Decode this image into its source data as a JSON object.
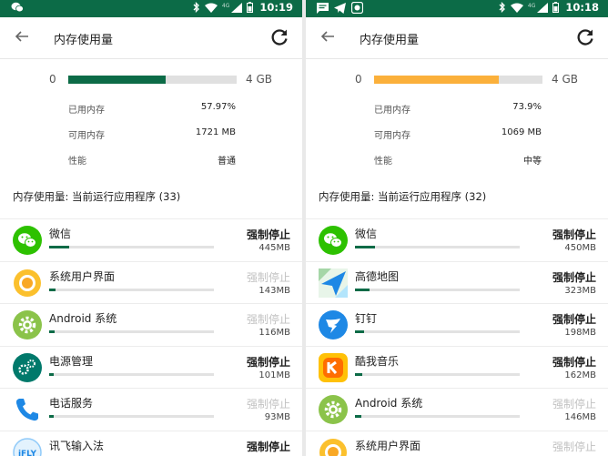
{
  "screens": [
    {
      "status": {
        "time": "10:19",
        "network": "4G"
      },
      "header": {
        "title": "内存使用量"
      },
      "summary": {
        "min": "0",
        "max": "4 GB",
        "fill_percent": 57.97,
        "bar_color": "#0c6b47",
        "stats": [
          {
            "label": "已用内存",
            "value": "57.97%"
          },
          {
            "label": "可用内存",
            "value": "1721 MB"
          },
          {
            "label": "性能",
            "value": "普通"
          }
        ]
      },
      "section_title": "内存使用量: 当前运行应用程序 (33)",
      "apps": [
        {
          "name": "微信",
          "action": "强制停止",
          "enabled": true,
          "size": "445MB",
          "usage": 0.12,
          "icon": "wechat-icon"
        },
        {
          "name": "系统用户界面",
          "action": "强制停止",
          "enabled": false,
          "size": "143MB",
          "usage": 0.04,
          "icon": "system-ui-icon"
        },
        {
          "name": "Android 系统",
          "action": "强制停止",
          "enabled": false,
          "size": "116MB",
          "usage": 0.035,
          "icon": "android-gear-icon"
        },
        {
          "name": "电源管理",
          "action": "强制停止",
          "enabled": true,
          "size": "101MB",
          "usage": 0.03,
          "icon": "power-manager-icon"
        },
        {
          "name": "电话服务",
          "action": "强制停止",
          "enabled": false,
          "size": "93MB",
          "usage": 0.025,
          "icon": "phone-icon"
        },
        {
          "name": "讯飞输入法",
          "action": "强制停止",
          "enabled": true,
          "size": "",
          "usage": 0.02,
          "icon": "iflytek-icon"
        }
      ]
    },
    {
      "status": {
        "time": "10:18",
        "network": "4G"
      },
      "header": {
        "title": "内存使用量"
      },
      "summary": {
        "min": "0",
        "max": "4 GB",
        "fill_percent": 73.9,
        "bar_color": "#fbb03b",
        "stats": [
          {
            "label": "已用内存",
            "value": "73.9%"
          },
          {
            "label": "可用内存",
            "value": "1069 MB"
          },
          {
            "label": "性能",
            "value": "中等"
          }
        ]
      },
      "section_title": "内存使用量: 当前运行应用程序 (32)",
      "apps": [
        {
          "name": "微信",
          "action": "强制停止",
          "enabled": true,
          "size": "450MB",
          "usage": 0.12,
          "icon": "wechat-icon"
        },
        {
          "name": "高德地图",
          "action": "强制停止",
          "enabled": true,
          "size": "323MB",
          "usage": 0.09,
          "icon": "amap-icon"
        },
        {
          "name": "钉钉",
          "action": "强制停止",
          "enabled": true,
          "size": "198MB",
          "usage": 0.055,
          "icon": "dingtalk-icon"
        },
        {
          "name": "酷我音乐",
          "action": "强制停止",
          "enabled": true,
          "size": "162MB",
          "usage": 0.045,
          "icon": "kuwo-music-icon"
        },
        {
          "name": "Android 系统",
          "action": "强制停止",
          "enabled": false,
          "size": "146MB",
          "usage": 0.04,
          "icon": "android-gear-icon"
        },
        {
          "name": "系统用户界面",
          "action": "强制停止",
          "enabled": false,
          "size": "",
          "usage": 0.035,
          "icon": "system-ui-icon"
        }
      ]
    }
  ]
}
